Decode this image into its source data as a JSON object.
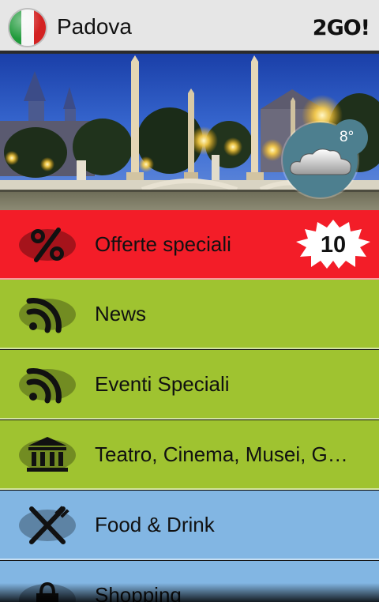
{
  "header": {
    "city": "Padova",
    "brand": "2GO!"
  },
  "weather": {
    "temperature": "8°"
  },
  "menu": [
    {
      "label": "Offerte speciali",
      "icon": "percent-icon",
      "badge": "10",
      "color": "#f31d28"
    },
    {
      "label": "News",
      "icon": "rss-icon",
      "color": "#9fc330"
    },
    {
      "label": "Eventi Speciali",
      "icon": "rss-icon",
      "color": "#9fc330"
    },
    {
      "label": "Teatro, Cinema, Musei, G…",
      "icon": "museum-icon",
      "color": "#9fc330"
    },
    {
      "label": "Food & Drink",
      "icon": "fork-knife-icon",
      "color": "#82b6e3"
    },
    {
      "label": "Shopping",
      "icon": "shopping-bag-icon",
      "color": "#82b6e3"
    }
  ],
  "flag": {
    "colors": [
      "#1f9a3a",
      "#f5f5f5",
      "#d32222"
    ]
  }
}
